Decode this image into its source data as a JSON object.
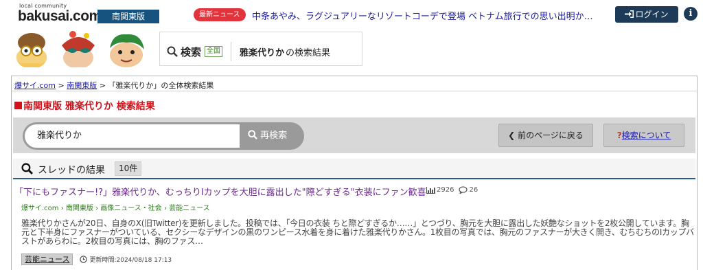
{
  "header": {
    "logo_small": "local community",
    "logo_main": "bakusai",
    "logo_tld": ".com",
    "region": "南関東版",
    "news_badge": "最新ニュース",
    "news_headline": "中条あやみ、ラグジュアリーなリゾートコーデで登場 ベトナム旅行での思い出明か…",
    "login_label": "ログイン",
    "info_icon": "info-icon",
    "colors": {
      "region_bg": "#16537e",
      "news_badge_bg": "#e2343c",
      "login_bg": "#1d3b59"
    }
  },
  "search_title": {
    "search_label": "検索",
    "scope": "全国",
    "query": "雅楽代りか",
    "suffix": "の検索結果"
  },
  "breadcrumb": {
    "items": [
      "爆サイ.com",
      "南関東版"
    ],
    "current": "「雅楽代りか」の全体検索結果"
  },
  "result_heading": "南関東版 雅楽代りか 検索結果",
  "search_form": {
    "value": "雅楽代りか",
    "button_label": "再検索",
    "prev_label": "前のページに戻る",
    "about_label": "検索について"
  },
  "threads": {
    "label": "スレッドの結果",
    "count": "10件",
    "items": [
      {
        "title": "「下にもファスナー!?」雅楽代りか、むっちりIカップを大胆に露出した\"際どすぎる\"衣装にファン歓喜",
        "views": "2926",
        "comments": "26",
        "crumb": [
          "爆サイ.com",
          "南関東版",
          "画像ニュース・社会",
          "芸能ニュース"
        ],
        "body": "雅楽代りかさんが20日、自身のX(旧Twitter)を更新しました。投稿では、「今日の衣装 ちと際どすぎるか……」とつづり、胸元を大胆に露出した妖艶なショットを2枚公開しています。胸元と下半身にファスナーがついている、セクシーなデザインの黒のワンピース水着を身に着けた雅楽代りかさん。1枚目の写真では、胸元のファスナーが大きく開き、むちむちのIカップバストがあらわに。2枚目の写真には、胸のファス…",
        "category": "芸能ニュース",
        "updated": "更新時間:2024/08/18 17:13"
      }
    ]
  },
  "accent_colors": {
    "heading_red": "#d0141c",
    "thread_title": "#6b2a8c",
    "crumb_green": "#2e7d1c",
    "rule_blue": "#2c5d86"
  }
}
